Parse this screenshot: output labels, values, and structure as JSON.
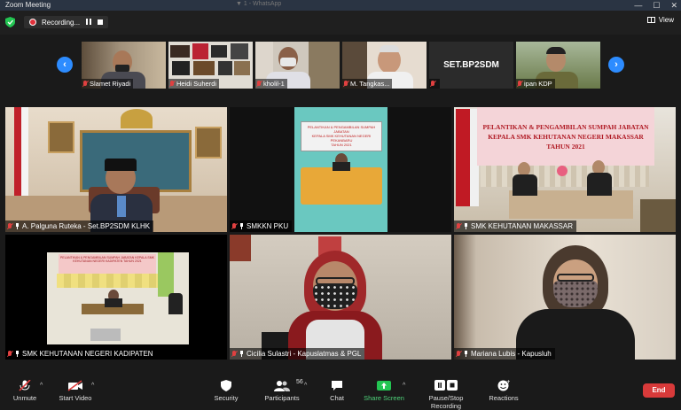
{
  "window": {
    "title": "Zoom Meeting",
    "ghost_title": "▼ 1 - WhatsApp",
    "controls": [
      "—",
      "☐",
      "✕"
    ]
  },
  "topbar": {
    "recording_label": "Recording...",
    "view_label": "View"
  },
  "strip": {
    "prev_arrow": "‹",
    "next_arrow": "›",
    "thumbnails": [
      {
        "name": "Slamet Riyadi",
        "muted": true
      },
      {
        "name": "Heidi Suherdi",
        "muted": true
      },
      {
        "name": "kholil-1",
        "muted": true
      },
      {
        "name": "M. Tangkas...",
        "muted": true
      },
      {
        "name": "",
        "display_text": "SET.BP2SDM",
        "muted": true
      },
      {
        "name": "ipan KDP",
        "muted": true
      }
    ]
  },
  "tiles": [
    {
      "name": "A. Palguna Ruteka - Set.BP2SDM KLHK",
      "muted": true
    },
    {
      "name": "SMKKN PKU",
      "muted": true,
      "banner": "PELANTIKAN & PENGAMBILAN SUMPAH JABATAN\nKEPALA SMK KEHUTANAN NEGERI PEKANBARU\nTAHUN 2021"
    },
    {
      "name": "SMK KEHUTANAN MAKASSAR",
      "muted": true,
      "banner_line1": "PELANTIKAN & PENGAMBILAN SUMPAH JABATAN",
      "banner_line2": "KEPALA SMK KEHUTANAN NEGERI MAKASSAR",
      "banner_line3": "TAHUN 2021"
    },
    {
      "name": "SMK KEHUTANAN NEGERI KADIPATEN",
      "muted": true,
      "banner": "PELANTIKAN & PENGAMBILAN SUMPAH JABATAN KEPALA SMK KEHUTANAN NEGERI KADIPATEN TAHUN 2021"
    },
    {
      "name": "Cicilia Sulastri - Kapuslatmas & PGL",
      "muted": true
    },
    {
      "name": "Mariana Lubis - Kapusluh",
      "muted": true
    }
  ],
  "toolbar": {
    "unmute": "Unmute",
    "start_video": "Start Video",
    "security": "Security",
    "participants": "Participants",
    "participants_count": "56",
    "chat": "Chat",
    "share_screen": "Share Screen",
    "pause_stop_recording": "Pause/Stop Recording",
    "reactions": "Reactions",
    "end": "End",
    "caret": "^"
  },
  "colors": {
    "accent_blue": "#2d8cff",
    "end_red": "#d83a3a",
    "share_green": "#23c552",
    "muted_red": "#e04040"
  }
}
